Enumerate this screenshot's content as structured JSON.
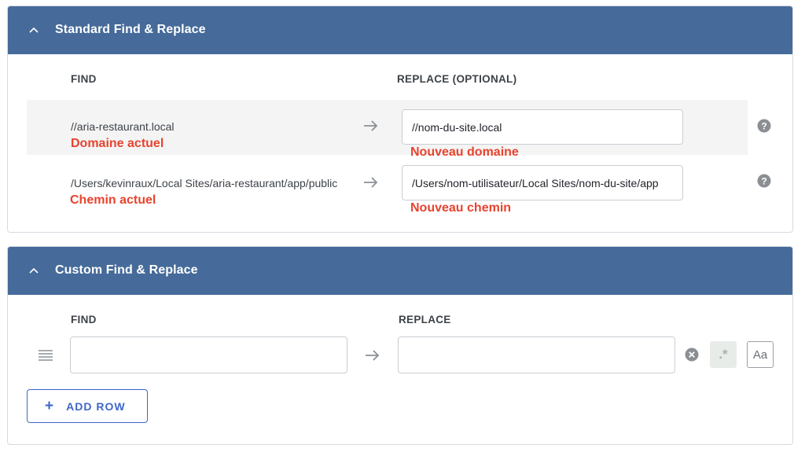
{
  "standard": {
    "title": "Standard Find & Replace",
    "find_header": "FIND",
    "replace_header": "REPLACE (OPTIONAL)",
    "rows": [
      {
        "find": "//aria-restaurant.local",
        "replace_value": "//nom-du-site.local",
        "find_annotation": "Domaine actuel",
        "replace_annotation": "Nouveau domaine"
      },
      {
        "find": "/Users/kevinraux/Local Sites/aria-restaurant/app/public",
        "replace_value": "/Users/nom-utilisateur/Local Sites/nom-du-site/app",
        "find_annotation": "Chemin actuel",
        "replace_annotation": "Nouveau chemin"
      }
    ]
  },
  "custom": {
    "title": "Custom Find & Replace",
    "find_header": "FIND",
    "replace_header": "REPLACE",
    "row": {
      "find_value": "",
      "replace_value": "",
      "regex_label": ".*",
      "case_label": "Aa"
    },
    "add_row_label": "ADD ROW",
    "add_row_icon": "+"
  },
  "colors": {
    "header_bg": "#466b9a",
    "annotation": "#e8432e",
    "accent": "#3f67c9"
  }
}
